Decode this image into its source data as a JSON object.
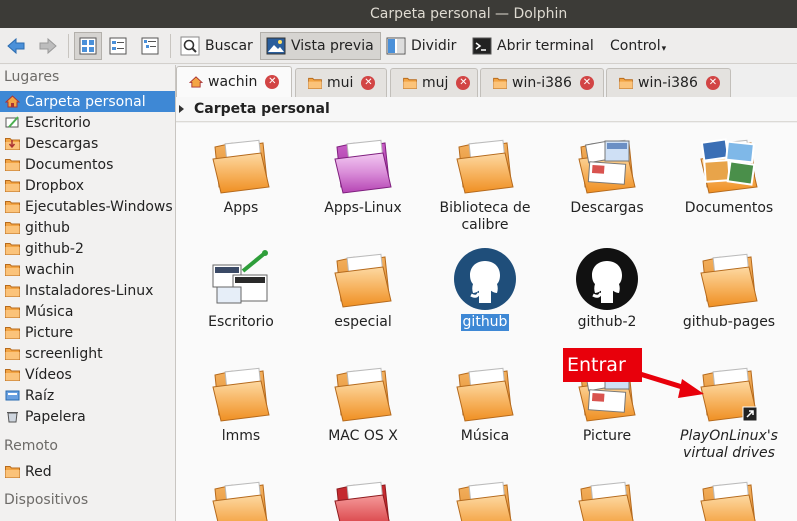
{
  "window": {
    "title": "Carpeta personal — Dolphin"
  },
  "toolbar": {
    "buscar": "Buscar",
    "vista_previa": "Vista previa",
    "dividir": "Dividir",
    "abrir_terminal": "Abrir terminal",
    "control": "Control"
  },
  "sidebar": {
    "lugares_heading": "Lugares",
    "lugares": [
      "Carpeta personal",
      "Escritorio",
      "Descargas",
      "Documentos",
      "Dropbox",
      "Ejecutables-Windows",
      "github",
      "github-2",
      "wachin",
      "Instaladores-Linux",
      "Música",
      "Picture",
      "screenlight",
      "Vídeos",
      "Raíz",
      "Papelera"
    ],
    "remoto_heading": "Remoto",
    "remoto": [
      "Red"
    ],
    "dispositivos_heading": "Dispositivos"
  },
  "tabs": [
    "wachin",
    "mui",
    "muj",
    "win-i386",
    "win-i386"
  ],
  "breadcrumb": {
    "path": "Carpeta personal"
  },
  "files": [
    {
      "name": "Apps",
      "icon": "folder"
    },
    {
      "name": "Apps-Linux",
      "icon": "folder-pink"
    },
    {
      "name": "Biblioteca de calibre",
      "icon": "folder"
    },
    {
      "name": "Descargas",
      "icon": "folder-preview"
    },
    {
      "name": "Documentos",
      "icon": "folder-photos"
    },
    {
      "name": "Escritorio",
      "icon": "desktop-screenshot"
    },
    {
      "name": "especial",
      "icon": "folder"
    },
    {
      "name": "github",
      "icon": "github-logo-blue"
    },
    {
      "name": "github-2",
      "icon": "github-logo-black"
    },
    {
      "name": "github-pages",
      "icon": "folder"
    },
    {
      "name": "lmms",
      "icon": "folder"
    },
    {
      "name": "MAC OS X",
      "icon": "folder"
    },
    {
      "name": "Música",
      "icon": "folder"
    },
    {
      "name": "Picture",
      "icon": "folder-preview"
    },
    {
      "name": "PlayOnLinux's virtual drives",
      "icon": "folder-link"
    }
  ],
  "annotation": {
    "text": "Entrar"
  },
  "colors": {
    "selection": "#3e88d5",
    "folder": "#f6a23a",
    "annotation": "#e8000b"
  }
}
